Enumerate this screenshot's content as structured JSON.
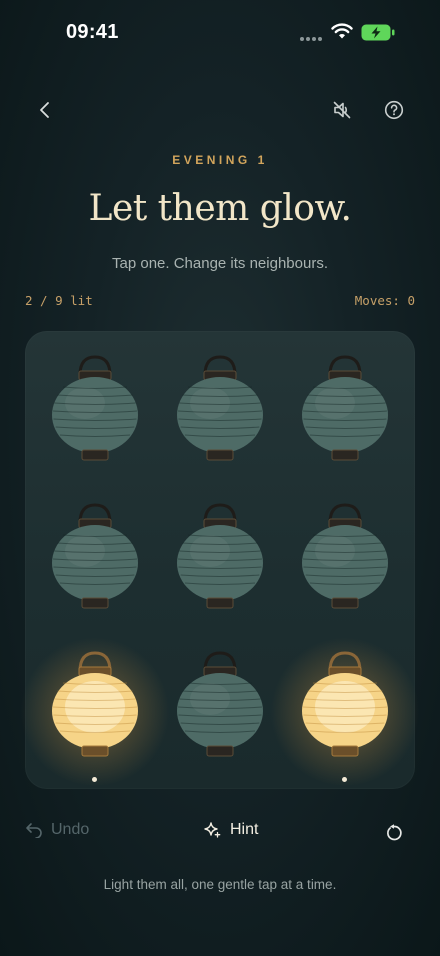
{
  "status_bar": {
    "time": "09:41"
  },
  "header": {
    "back_icon": "chevron-left-icon",
    "mute_icon": "speaker-muted-icon",
    "help_icon": "question-circle-icon"
  },
  "level": {
    "eyebrow": "EVENING 1"
  },
  "title": "Let them glow.",
  "subtitle": "Tap one. Change its neighbours.",
  "stats": {
    "lit_label": "2 / 9 lit",
    "moves_label": "Moves: 0",
    "lit": 2,
    "total": 9,
    "moves": 0
  },
  "board": {
    "lanterns": [
      {
        "row": 1,
        "col": 1,
        "lit": false
      },
      {
        "row": 1,
        "col": 2,
        "lit": false
      },
      {
        "row": 1,
        "col": 3,
        "lit": false
      },
      {
        "row": 2,
        "col": 1,
        "lit": false
      },
      {
        "row": 2,
        "col": 2,
        "lit": false
      },
      {
        "row": 2,
        "col": 3,
        "lit": false
      },
      {
        "row": 3,
        "col": 1,
        "lit": true
      },
      {
        "row": 3,
        "col": 2,
        "lit": false
      },
      {
        "row": 3,
        "col": 3,
        "lit": true
      }
    ]
  },
  "controls": {
    "undo_label": "Undo",
    "undo_icon": "undo-arrow-icon",
    "hint_label": "Hint",
    "hint_icon": "sparkle-icon",
    "reset_icon": "reset-icon"
  },
  "footer": "Light them all, one gentle tap at a time.",
  "colors": {
    "accent": "#d2a55c",
    "title": "#f2e6c8",
    "lantern_unlit": "#4e6b66",
    "lantern_lit": "#f6d488",
    "background": "#142226"
  }
}
